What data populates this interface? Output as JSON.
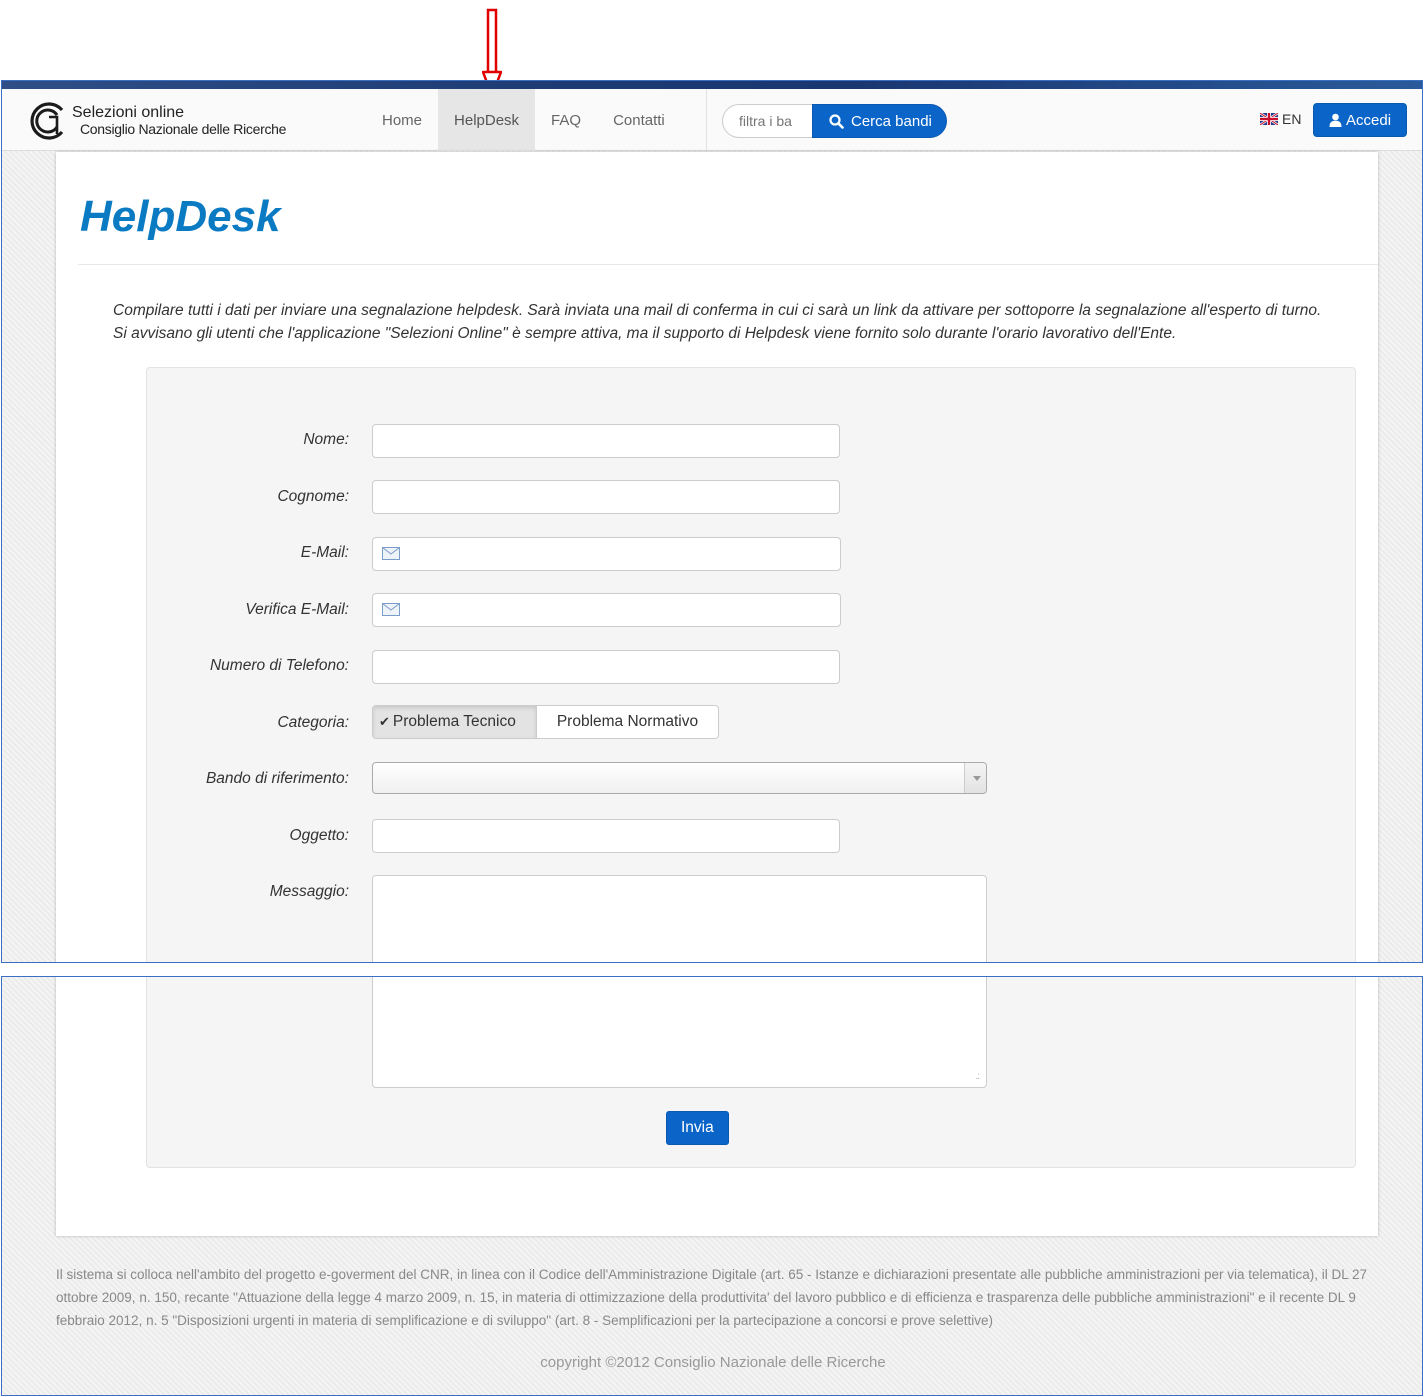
{
  "header": {
    "logo_title": "Selezioni online",
    "logo_subtitle": "Consiglio Nazionale delle Ricerche"
  },
  "nav": [
    {
      "label": "Home",
      "active": false
    },
    {
      "label": "HelpDesk",
      "active": true
    },
    {
      "label": "FAQ",
      "active": false
    },
    {
      "label": "Contatti",
      "active": false
    }
  ],
  "search": {
    "placeholder": "filtra i ba",
    "button_label": "Cerca bandi"
  },
  "language": "EN",
  "login_label": "Accedi",
  "page": {
    "title": "HelpDesk",
    "intro_1": "Compilare tutti i dati per inviare una segnalazione helpdesk. Sarà inviata una mail di conferma in cui ci sarà un link da attivare per sottoporre la segnalazione all'esperto di turno.",
    "intro_2": "Si avvisano gli utenti che l'applicazione \"Selezioni Online\" è sempre attiva, ma il supporto di Helpdesk viene fornito solo durante l'orario lavorativo dell'Ente."
  },
  "form": {
    "labels": {
      "nome": "Nome:",
      "cognome": "Cognome:",
      "email": "E-Mail:",
      "verifica_email": "Verifica E-Mail:",
      "telefono": "Numero di Telefono:",
      "categoria": "Categoria:",
      "bando": "Bando di riferimento:",
      "oggetto": "Oggetto:",
      "messaggio": "Messaggio:"
    },
    "values": {
      "nome": "",
      "cognome": "",
      "email": "",
      "verifica_email": "",
      "telefono": "",
      "bando": "",
      "oggetto": "",
      "messaggio": ""
    },
    "categoria_options": [
      {
        "label": "Problema Tecnico",
        "selected": true
      },
      {
        "label": "Problema Normativo",
        "selected": false
      }
    ],
    "submit_label": "Invia"
  },
  "footer": {
    "text": "Il sistema si colloca nell'ambito del progetto e-goverment del CNR, in linea con il Codice dell'Amministrazione Digitale (art. 65 - Istanze e dichiarazioni presentate alle pubbliche amministrazioni per via telematica), il DL 27 ottobre 2009, n. 150, recante \"Attuazione della legge 4 marzo 2009, n. 15, in materia di ottimizzazione della produttivita' del lavoro pubblico e di efficienza e trasparenza delle pubbliche amministrazioni\" e il recente DL 9 febbraio 2012, n. 5 \"Disposizioni urgenti in materia di semplificazione e di sviluppo\" (art. 8 - Semplificazioni per la partecipazione a concorsi e prove selettive)",
    "copyright": "copyright ©2012 Consiglio Nazionale delle Ricerche"
  },
  "colors": {
    "accent": "#0b64c8",
    "title": "#0a7ac2",
    "annotation_arrow": "#e00000",
    "frame_border": "#3b6fc4"
  }
}
